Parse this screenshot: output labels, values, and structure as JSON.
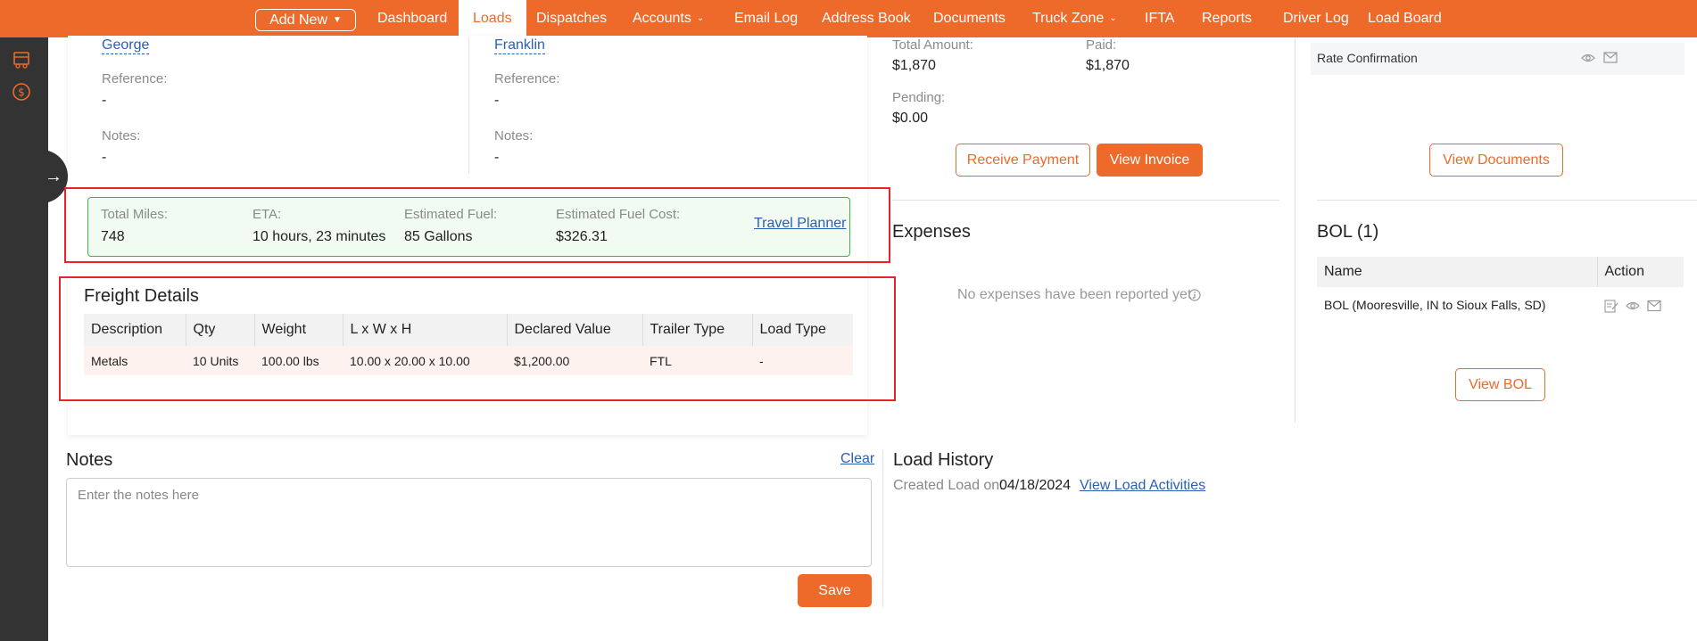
{
  "nav": {
    "add_new": "Add New",
    "items": [
      "Dashboard",
      "Loads",
      "Dispatches",
      "Accounts",
      "Email Log",
      "Address Book",
      "Documents",
      "Truck Zone",
      "IFTA",
      "Reports",
      "Driver Log",
      "Load Board"
    ],
    "active": "Loads"
  },
  "shipper": {
    "name": "George",
    "reference_label": "Reference:",
    "reference": "-",
    "notes_label": "Notes:",
    "notes": "-"
  },
  "consignee": {
    "name": "Franklin",
    "reference_label": "Reference:",
    "reference": "-",
    "notes_label": "Notes:",
    "notes": "-"
  },
  "trip": {
    "miles_label": "Total Miles:",
    "miles": "748",
    "eta_label": "ETA:",
    "eta": "10 hours, 23 minutes",
    "fuel_label": "Estimated Fuel:",
    "fuel": "85 Gallons",
    "fuel_cost_label": "Estimated Fuel Cost:",
    "fuel_cost": "$326.31",
    "planner_link": "Travel Planner"
  },
  "freight": {
    "title": "Freight Details",
    "headers": [
      "Description",
      "Qty",
      "Weight",
      "L x W x H",
      "Declared Value",
      "Trailer Type",
      "Load Type"
    ],
    "row": [
      "Metals",
      "10 Units",
      "100.00 lbs",
      "10.00 x 20.00 x 10.00",
      "$1,200.00",
      "FTL",
      "-"
    ]
  },
  "payment": {
    "total_label": "Total Amount:",
    "total": "$1,870",
    "paid_label": "Paid:",
    "paid": "$1,870",
    "pending_label": "Pending:",
    "pending": "$0.00",
    "receive_button": "Receive Payment",
    "invoice_button": "View Invoice"
  },
  "expenses": {
    "title": "Expenses",
    "empty": "No expenses have been reported yet."
  },
  "documents": {
    "row": "Rate Confirmation",
    "view_button": "View Documents"
  },
  "bol": {
    "title": "BOL (1)",
    "headers": [
      "Name",
      "Action"
    ],
    "row": "BOL (Mooresville, IN to Sioux Falls, SD)",
    "view_button": "View BOL"
  },
  "notes": {
    "title": "Notes",
    "clear": "Clear",
    "placeholder": "Enter the notes here",
    "save": "Save"
  },
  "history": {
    "title": "Load History",
    "created_label": "Created Load on:",
    "created_date": "04/18/2024",
    "activities_link": "View Load Activities"
  },
  "colors": {
    "brand": "#ee6a2a",
    "sidebar": "#333333",
    "highlight": "#e5252a",
    "trip_border": "#49b049"
  }
}
